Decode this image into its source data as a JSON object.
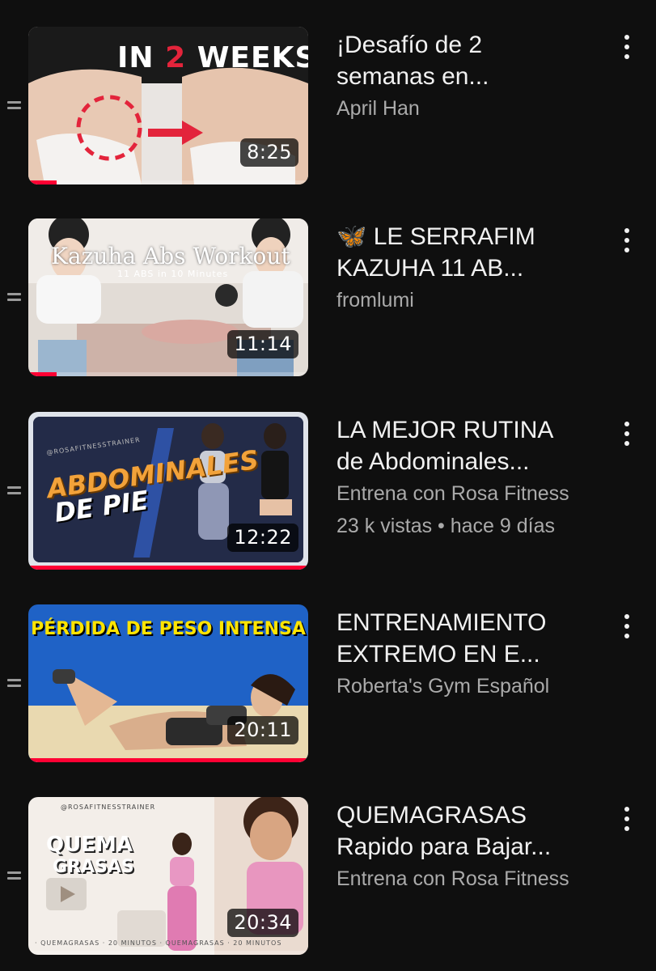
{
  "colors": {
    "background": "#0f0f0f",
    "title_text": "#f1f1f1",
    "secondary_text": "#aaaaaa",
    "progress_red": "#ff0033"
  },
  "icons": {
    "drag": "drag-handle-icon",
    "more": "more-vert-icon"
  },
  "videos": [
    {
      "thumbnail_text": [
        "IN",
        "2",
        "WEEKS"
      ],
      "duration": "8:25",
      "watched_progress": 0.1,
      "title_line1": "¡Desafío de 2",
      "title_line2": "semanas en...",
      "channel": "April Han",
      "stats": ""
    },
    {
      "thumbnail_text": [
        "Kazuha Abs Workout",
        "11 ABS in 10 Minutes"
      ],
      "duration": "11:14",
      "watched_progress": 0.1,
      "title_line1": "🦋 LE SERRAFIM",
      "title_line2": "KAZUHA 11 AB...",
      "channel": "fromlumi",
      "stats": ""
    },
    {
      "thumbnail_text": [
        "ABDOMINALES",
        "DE PIE",
        "@ROSAFITNESSTRAINER"
      ],
      "duration": "12:22",
      "watched_progress": 1.0,
      "title_line1": "LA MEJOR RUTINA",
      "title_line2": "de Abdominales...",
      "channel": "Entrena con Rosa Fitness",
      "stats": "23 k vistas • hace 9 días"
    },
    {
      "thumbnail_text": [
        "PÉRDIDA DE PESO INTENSA"
      ],
      "duration": "20:11",
      "watched_progress": 1.0,
      "title_line1": "ENTRENAMIENTO",
      "title_line2": "EXTREMO EN E...",
      "channel": "Roberta's Gym Español",
      "stats": ""
    },
    {
      "thumbnail_text": [
        "@ROSAFITNESSTRAINER",
        "QUEMA",
        "GRASAS",
        "· QUEMAGRASAS · 20 MINUTOS · QUEMAGRASAS · 20 MINUTOS"
      ],
      "duration": "20:34",
      "watched_progress": 0.0,
      "title_line1": "QUEMAGRASAS",
      "title_line2": "Rapido para Bajar...",
      "channel": "Entrena con Rosa Fitness",
      "stats": ""
    }
  ]
}
